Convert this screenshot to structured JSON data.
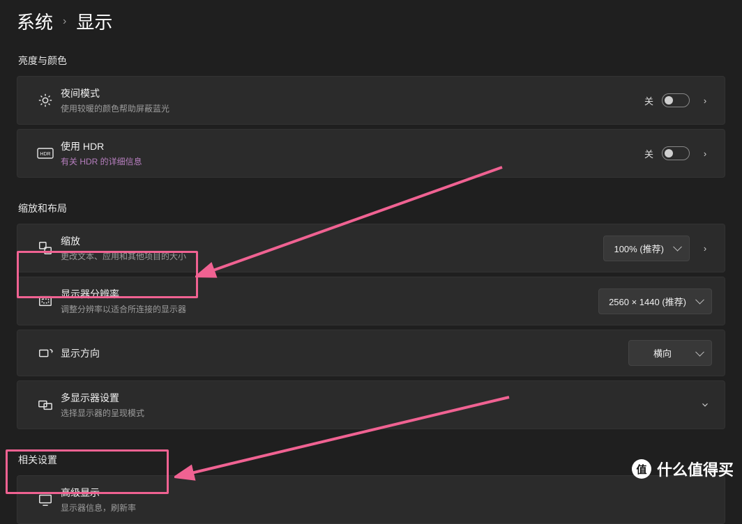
{
  "breadcrumb": {
    "root": "系统",
    "page": "显示"
  },
  "sections": {
    "brightness_color": "亮度与颜色",
    "scale_layout": "缩放和布局",
    "related": "相关设置"
  },
  "night_light": {
    "title": "夜间模式",
    "sub": "使用较暖的颜色帮助屏蔽蓝光",
    "state": "关"
  },
  "hdr": {
    "title": "使用 HDR",
    "sub": "有关 HDR 的详细信息",
    "state": "关"
  },
  "scale": {
    "title": "缩放",
    "sub": "更改文本、应用和其他项目的大小",
    "value": "100% (推荐)"
  },
  "resolution": {
    "title": "显示器分辨率",
    "sub": "调整分辨率以适合所连接的显示器",
    "value": "2560 × 1440 (推荐)"
  },
  "orientation": {
    "title": "显示方向",
    "value": "横向"
  },
  "multi": {
    "title": "多显示器设置",
    "sub": "选择显示器的呈现模式"
  },
  "advanced": {
    "title": "高级显示",
    "sub": "显示器信息，刷新率"
  },
  "watermark": "什么值得买"
}
